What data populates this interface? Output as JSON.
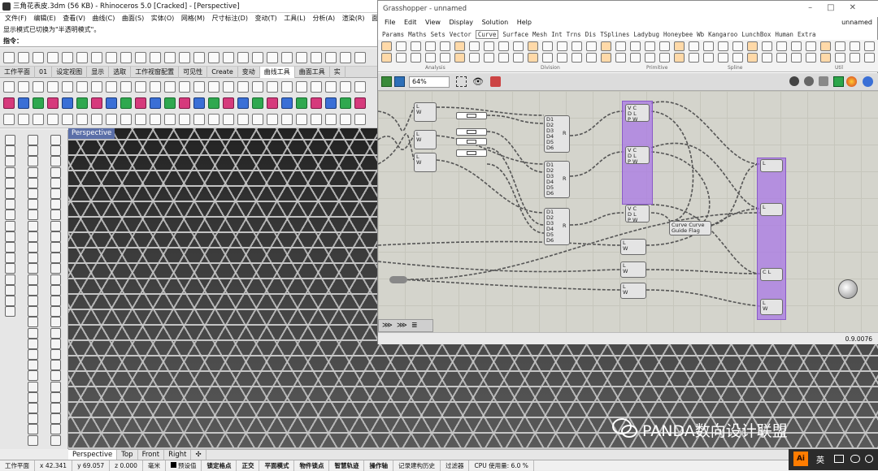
{
  "rhino": {
    "title": "三角花表皮.3dm (56 KB) - Rhinoceros 5.0 [Cracked] - [Perspective]",
    "menu": [
      "文件(F)",
      "编辑(E)",
      "查看(V)",
      "曲线(C)",
      "曲面(S)",
      "实体(O)",
      "网格(M)",
      "尺寸标注(D)",
      "变动(T)",
      "工具(L)",
      "分析(A)",
      "渲染(R)",
      "面"
    ],
    "status_message": "显示模式已切换为\"半透明模式\"。",
    "command_prompt": "指令：",
    "tabs": [
      "工作平面",
      "01",
      "设定视图",
      "显示",
      "选取",
      "工作视窗配置",
      "可见性",
      "Create",
      "变动",
      "曲线工具",
      "曲面工具",
      "实"
    ],
    "active_tab": "曲线工具",
    "viewport_label": "Perspective",
    "viewport_tabs": [
      "Perspective",
      "Top",
      "Front",
      "Right"
    ],
    "statusbar": {
      "cplane": "工作平面",
      "x": "x 42.341",
      "y": "y 69.057",
      "z": "z 0.000",
      "unit": "毫米",
      "layer": "预设值",
      "osnap": "锁定格点",
      "ortho": "正交",
      "planar": "平面模式",
      "object_snap": "物件锁点",
      "smart_track": "智慧轨迹",
      "gumball": "操作轴",
      "history": "记录建构历史",
      "filter": "过滤器",
      "cpu": "CPU 使用量: 6.0 %"
    }
  },
  "grasshopper": {
    "title": "Grasshopper - unnamed",
    "window_buttons": [
      "–",
      "□",
      "✕"
    ],
    "document_name": "unnamed",
    "menu": [
      "File",
      "Edit",
      "View",
      "Display",
      "Solution",
      "Help"
    ],
    "tabs": [
      "Params",
      "Maths",
      "Sets",
      "Vector",
      "Curve",
      "Surface",
      "Mesh",
      "Int",
      "Trns",
      "Dis",
      "TSplines",
      "Ladybug",
      "Honeybee",
      "Wb",
      "Kangaroo",
      "LunchBox",
      "Human",
      "Extra"
    ],
    "active_tab": "Curve",
    "ribbon_groups": [
      "Analysis",
      "Division",
      "Primitive",
      "Spline",
      "Util"
    ],
    "zoom": "64%",
    "version": "0.9.0076",
    "nodes": {
      "curve_label_1": "Curve",
      "guide_label": "Guide",
      "curve_label_2": "Curve",
      "flag_label": "Flag",
      "d_inputs": [
        "D1",
        "D2",
        "D3",
        "D4",
        "D5",
        "D6"
      ],
      "l_port": "L",
      "w_port": "W",
      "v_port": "V",
      "c_port": "C",
      "d_port": "D",
      "p_port": "P",
      "r_port": "R"
    }
  },
  "watermark": "PANDA数向设计联盟",
  "tray": {
    "app_badge": "Ai",
    "lang": "英"
  },
  "colors": {
    "group_purple": "#b48ae6",
    "viewport_bg": "#3a3a3a",
    "gh_canvas": "#d4d4cc"
  }
}
